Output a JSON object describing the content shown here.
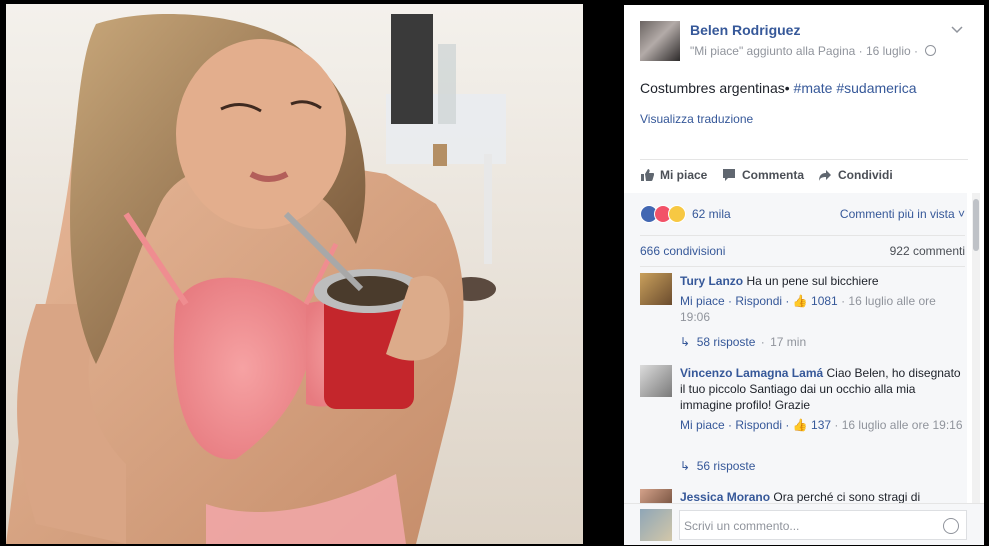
{
  "photo": {
    "description_icon": "photo"
  },
  "post": {
    "author": "Belen Rodriguez",
    "meta": "\"Mi piace\" aggiunto alla Pagina · 16 luglio ·",
    "text_plain": "Costumbres argentinas•",
    "tag1": "#mate",
    "tag2": "#sudamerica",
    "translate": "Visualizza traduzione"
  },
  "actions": {
    "like": "Mi piace",
    "comment": "Commenta",
    "share": "Condividi"
  },
  "reactions": {
    "count": "62 mila",
    "view_comments": "Commenti più in vista"
  },
  "stats": {
    "shares": "666 condivisioni",
    "comments": "922 commenti"
  },
  "comments": [
    {
      "name": "Tury Lanzo",
      "text": "Ha un pene sul bicchiere",
      "like": "Mi piace",
      "reply": "Rispondi",
      "likes": "1081",
      "time": "16 luglio alle ore 19:06",
      "replies": "58 risposte",
      "replies_time": "17 min"
    },
    {
      "name": "Vincenzo Lamagna Lamá",
      "text": "Ciao Belen, ho disegnato il tuo piccolo Santiago dai un occhio alla mia immagine profilo! Grazie",
      "like": "Mi piace",
      "reply": "Rispondi",
      "likes": "137",
      "time": "16 luglio alle ore 19:16",
      "replies": "56 risposte"
    },
    {
      "name": "Jessica Morano",
      "text": "Ora perché ci sono stragi di"
    }
  ],
  "compose": {
    "placeholder": "Scrivi un commento..."
  },
  "colors": {
    "link": "#365899",
    "muted": "#90949c",
    "panel": "#f6f7f9"
  }
}
